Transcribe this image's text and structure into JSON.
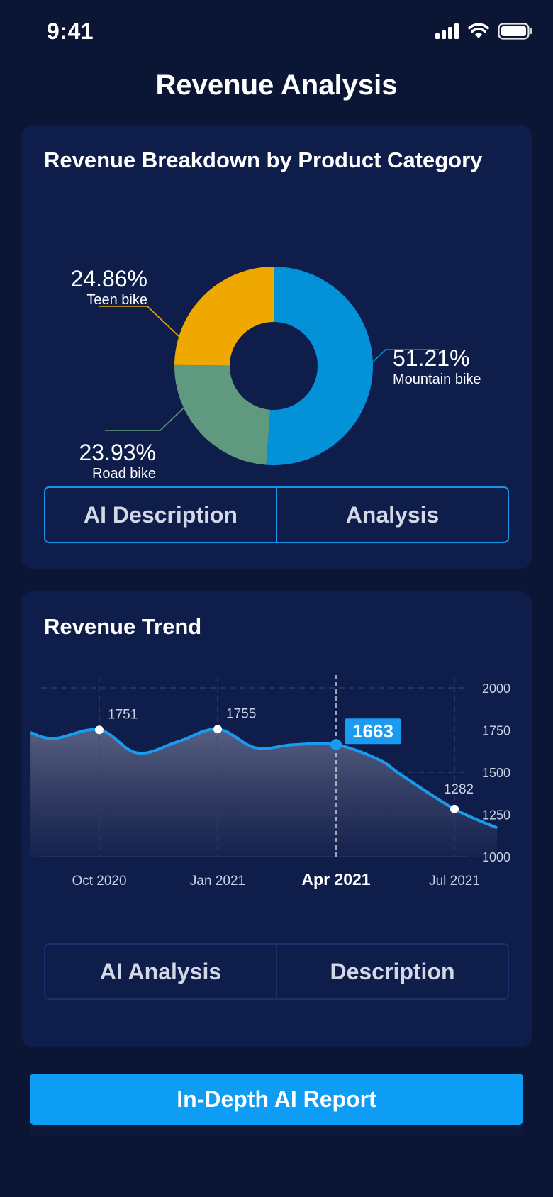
{
  "status_bar": {
    "time": "9:41"
  },
  "header": {
    "title": "Revenue Analysis"
  },
  "breakdown_card": {
    "title": "Revenue Breakdown by Product Category",
    "buttons": [
      "AI Description",
      "Analysis"
    ]
  },
  "trend_card": {
    "title": "Revenue Trend",
    "buttons": [
      "AI Analysis",
      "Description"
    ]
  },
  "cta": {
    "label": "In-Depth AI Report"
  },
  "colors": {
    "background": "#0a1633",
    "card": "#0e1d4a",
    "accent": "#0d9df5",
    "mountain": "#0391d8",
    "road": "#5f9a80",
    "teen": "#efa800"
  },
  "chart_data": [
    {
      "type": "pie",
      "donut": true,
      "title": "Revenue Breakdown by Product Category",
      "slices": [
        {
          "label": "Mountain bike",
          "value": 51.21,
          "display": "51.21%",
          "color": "#0391d8"
        },
        {
          "label": "Road bike",
          "value": 23.93,
          "display": "23.93%",
          "color": "#5f9a80"
        },
        {
          "label": "Teen bike",
          "value": 24.86,
          "display": "24.86%",
          "color": "#efa800"
        }
      ]
    },
    {
      "type": "area",
      "title": "Revenue Trend",
      "x_ticks": [
        "Oct 2020",
        "Jan 2021",
        "Apr 2021",
        "Jul 2021"
      ],
      "highlighted_tick": "Apr 2021",
      "y_ticks": [
        "2000",
        "1750",
        "1500",
        "1250",
        "1000"
      ],
      "ylim": [
        1000,
        2000
      ],
      "series": [
        {
          "points": [
            1735,
            1700,
            1751,
            1615,
            1680,
            1755,
            1645,
            1663,
            1663,
            1575,
            1480,
            1282,
            1170
          ],
          "point_positions": [
            -0.58,
            -0.38,
            0,
            0.32,
            0.66,
            1,
            1.32,
            1.64,
            2,
            2.36,
            2.56,
            3,
            3.36
          ]
        }
      ],
      "annotations": [
        {
          "position": 0,
          "value": 1751,
          "label": "1751"
        },
        {
          "position": 1,
          "value": 1755,
          "label": "1755"
        },
        {
          "position": 2,
          "value": 1663,
          "label": "1663",
          "highlight": true
        },
        {
          "position": 3,
          "value": 1282,
          "label": "1282"
        }
      ],
      "grid": true
    }
  ]
}
